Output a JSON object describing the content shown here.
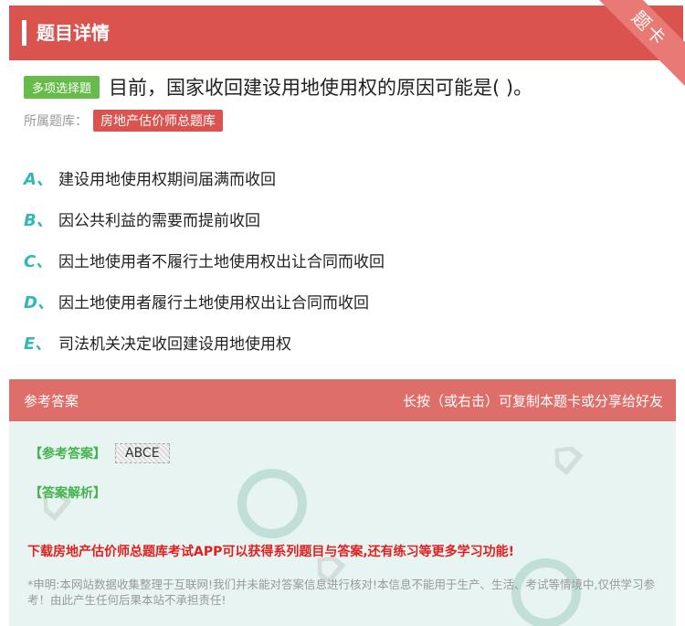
{
  "header": {
    "title": "题目详情",
    "ribbon": "题卡"
  },
  "question": {
    "type_badge": "多项选择题",
    "text": "目前，国家收回建设用地使用权的原因可能是( )。",
    "bank_label": "所属题库：",
    "bank_name": "房地产估价师总题库"
  },
  "options": [
    {
      "letter": "A、",
      "text": "建设用地使用权期间届满而收回"
    },
    {
      "letter": "B、",
      "text": "因公共利益的需要而提前收回"
    },
    {
      "letter": "C、",
      "text": "因土地使用者不履行土地使用权出让合同而收回"
    },
    {
      "letter": "D、",
      "text": "因土地使用者履行土地使用权出让合同而收回"
    },
    {
      "letter": "E、",
      "text": "司法机关决定收回建设用地使用权"
    }
  ],
  "answer": {
    "section_title": "参考答案",
    "hint": "长按（或右击）可复制本题卡或分享给好友",
    "ref_label": "【参考答案】",
    "ref_value": "ABCE",
    "analysis_label": "【答案解析】",
    "download_text": "下载房地产估价师总题库考试APP可以获得系列题目与答案,还有练习等更多学习功能!",
    "notice": "*申明:本网站数据收集整理于互联网!我们并未能对答案信息进行核对!本信息不能用于生产、生活、考试等情境中,仅供学习参考！由此产生任何后果本站不承担责任!"
  },
  "colors": {
    "header": "#d9534f",
    "badge": "#66bb4a",
    "option_letter": "#32b6b6",
    "answer_bg": "#e7f4f1"
  }
}
